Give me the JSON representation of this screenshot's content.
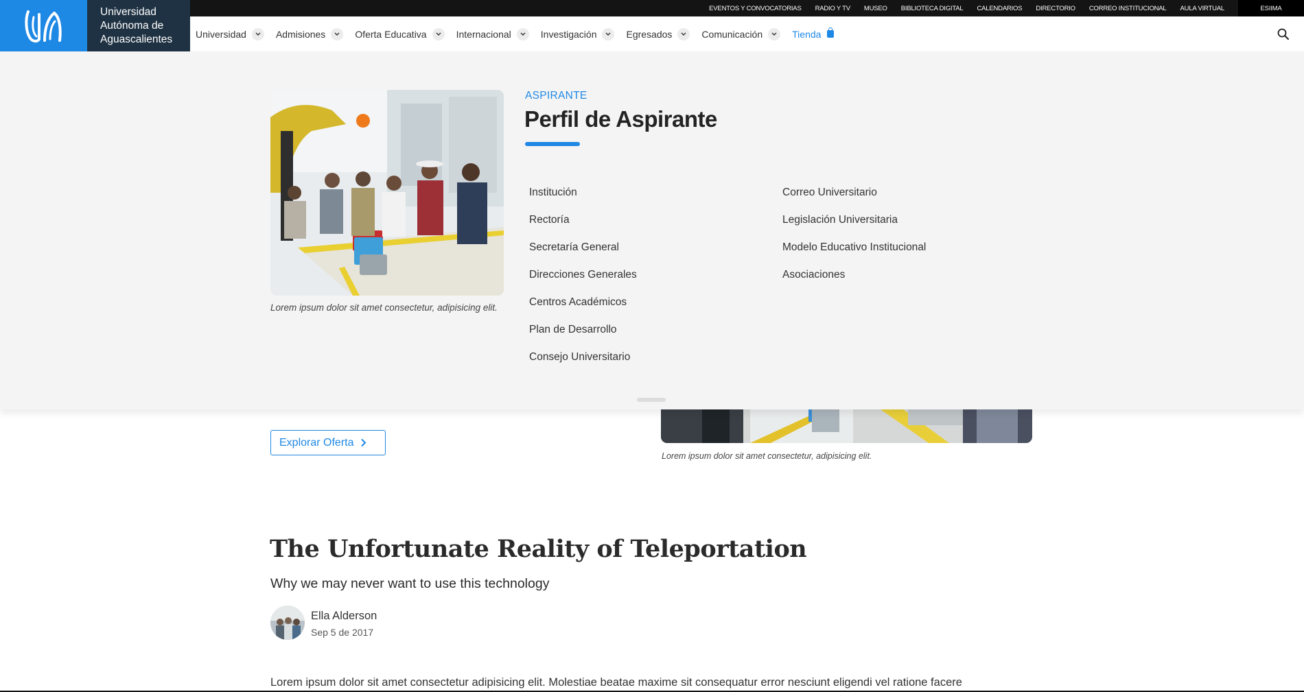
{
  "topbar": {
    "links": [
      "EVENTOS Y CONVOCATORIAS",
      "RADIO Y TV",
      "MUSEO",
      "BIBLIOTECA DIGITAL",
      "CALENDARIOS",
      "DIRECTORIO",
      "CORREO INSTITUCIONAL",
      "AULA VIRTUAL"
    ],
    "esima": "ESIIMA"
  },
  "brand": {
    "line1": "Universidad",
    "line2": "Autónoma de",
    "line3": "Aguascalientes"
  },
  "nav": {
    "items": [
      "Universidad",
      "Admisiones",
      "Oferta Educativa",
      "Internacional",
      "Investigación",
      "Egresados",
      "Comunicación"
    ],
    "store": "Tienda"
  },
  "mega": {
    "kicker": "ASPIRANTE",
    "title": "Perfil de Aspirante",
    "caption": "Lorem ipsum dolor sit amet consectetur, adipisicing elit.",
    "col1": [
      "Institución",
      "Rectoría",
      "Secretaría General",
      "Direcciones Generales",
      "Centros Académicos",
      "Plan de Desarrollo",
      "Consejo Universitario"
    ],
    "col2": [
      "Correo Universitario",
      "Legislación Universitaria",
      "Modelo Educativo Institucional",
      "Asociaciones"
    ]
  },
  "content": {
    "explore_label": "Explorar Oferta",
    "photo_caption": "Lorem ipsum dolor sit amet consectetur, adipisicing elit."
  },
  "article": {
    "title": "The Unfortunate Reality of Teleportation",
    "subtitle": "Why we may never want to use this technology",
    "author": "Ella Alderson",
    "date": "Sep 5 de 2017",
    "body": "Lorem ipsum dolor sit amet consectetur adipisicing elit. Molestiae beatae maxime sit consequatur error nesciunt eligendi vel ratione facere"
  },
  "colors": {
    "accent": "#1e88e5",
    "brand_dark": "#1f3243",
    "topbar": "#141414",
    "panel": "#f4f4f4"
  }
}
